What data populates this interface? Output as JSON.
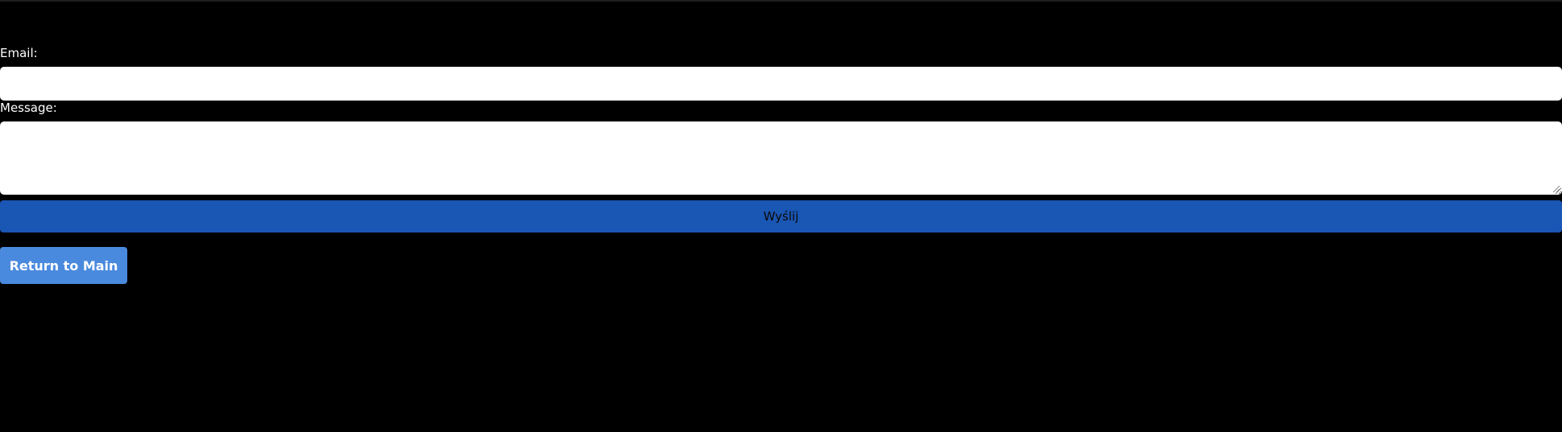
{
  "contact_form": {
    "email_label": "Email:",
    "email_value": "",
    "message_label": "Message:",
    "message_value": "",
    "submit_label": "Wyślij"
  },
  "navigation": {
    "return_label": "Return to Main"
  },
  "colors": {
    "background": "#000000",
    "submit_button": "#1a56b3",
    "return_button": "#4a8ade",
    "input_background": "#ffffff"
  }
}
